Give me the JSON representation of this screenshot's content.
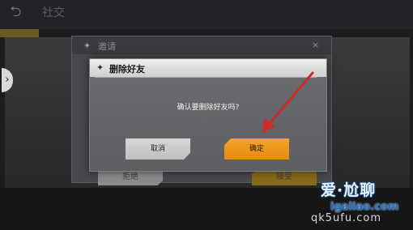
{
  "background": {
    "title": "社交",
    "dialog": {
      "title": "邀请",
      "close": "×",
      "reject_label": "拒绝",
      "accept_label": "接受"
    }
  },
  "delete_dialog": {
    "title": "删除好友",
    "icon": "game-emblem-icon",
    "message": "确认要删除好友吗?",
    "cancel_label": "取消",
    "confirm_label": "确定"
  },
  "watermark": {
    "line1": "爱·尬聊",
    "line2": "igaliao.com",
    "line3": "qk5ufu.com"
  },
  "colors": {
    "confirm": "#f5a623",
    "cancel": "#c9c9c9",
    "arrow": "#d22a2a"
  }
}
